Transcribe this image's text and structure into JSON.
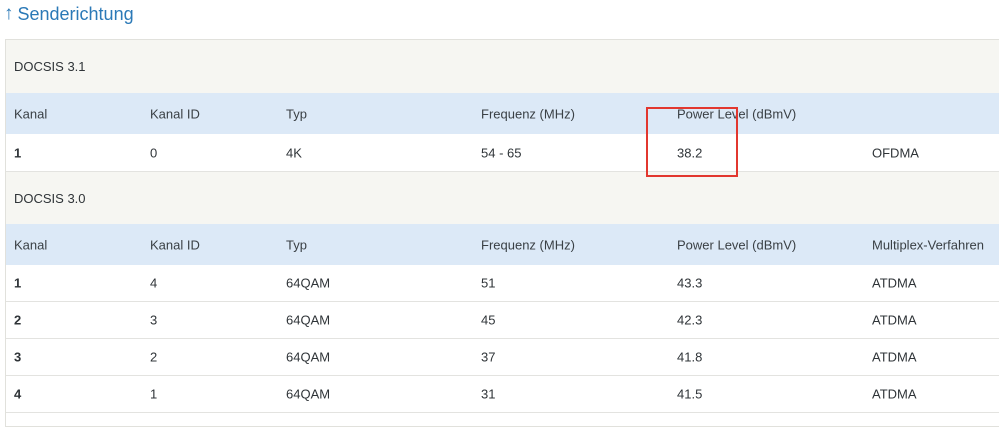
{
  "heading": {
    "arrow": "↑",
    "title": "Senderichtung"
  },
  "docsis31": {
    "section_label": "DOCSIS 3.1",
    "columns": [
      "Kanal",
      "Kanal ID",
      "Typ",
      "Frequenz (MHz)",
      "Power Level (dBmV)",
      ""
    ],
    "rows": [
      [
        "1",
        "0",
        "4K",
        "54 - 65",
        "38.2",
        "OFDMA"
      ]
    ]
  },
  "docsis30": {
    "section_label": "DOCSIS 3.0",
    "columns": [
      "Kanal",
      "Kanal ID",
      "Typ",
      "Frequenz (MHz)",
      "Power Level (dBmV)",
      "Multiplex-Verfahren"
    ],
    "rows": [
      [
        "1",
        "4",
        "64QAM",
        "51",
        "43.3",
        "ATDMA"
      ],
      [
        "2",
        "3",
        "64QAM",
        "45",
        "42.3",
        "ATDMA"
      ],
      [
        "3",
        "2",
        "64QAM",
        "37",
        "41.8",
        "ATDMA"
      ],
      [
        "4",
        "1",
        "64QAM",
        "31",
        "41.5",
        "ATDMA"
      ]
    ]
  },
  "colors": {
    "accent": "#2b79b7",
    "header_bg": "#dce9f7",
    "section_bg": "#f6f6f2",
    "highlight": "#e2372f"
  }
}
